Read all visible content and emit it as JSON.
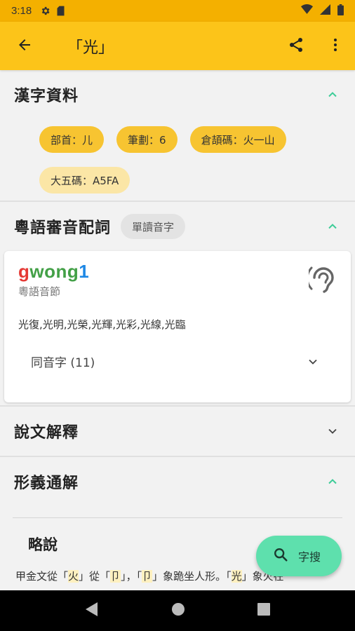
{
  "status_bar": {
    "time": "3:18",
    "icons": [
      "settings-icon",
      "sd-card-icon",
      "wifi-icon",
      "signal-icon",
      "battery-icon"
    ]
  },
  "app_bar": {
    "title": "「光」",
    "icons": {
      "back": "arrow-back-icon",
      "share": "share-icon",
      "more": "more-vert-icon"
    }
  },
  "sections": {
    "hanzi_info": {
      "title": "漢字資料",
      "chips": [
        {
          "label": "部首：儿"
        },
        {
          "label": "筆劃：6"
        },
        {
          "label": "倉頡碼：火一山"
        },
        {
          "label": "大五碼：A5FA"
        }
      ]
    },
    "cantonese": {
      "title": "粵語審音配詞",
      "tag": "單讀音字",
      "card": {
        "jyutping_parts": [
          "g",
          "wong",
          "1"
        ],
        "jyutping_caption": "粵語音節",
        "words": "光復,光明,光榮,光輝,光彩,光線,光臨",
        "homophones": "同音字 (11)"
      }
    },
    "shuowen": {
      "title": "說文解釋"
    },
    "xingyi": {
      "title": "形義通解",
      "subheading": "略說",
      "body_parts": [
        "甲金文從「",
        "火",
        "」從「",
        "卩",
        "」，「",
        "卩",
        "」象跪坐人形。「",
        "光",
        "」象火在"
      ]
    }
  },
  "fab": {
    "label": "字搜",
    "icon": "search-icon"
  },
  "colors": {
    "primary": "#fcc419",
    "status": "#f4b000",
    "accent": "#5ee0ad",
    "chip": "#f7c431",
    "chip_light": "#fbe6a6"
  }
}
